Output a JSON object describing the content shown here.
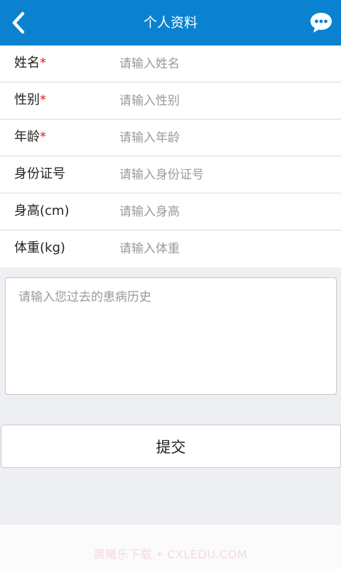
{
  "header": {
    "title": "个人资料",
    "back_icon": "chevron-left-icon",
    "chat_icon": "chat-bubble-icon"
  },
  "form": {
    "fields": [
      {
        "label": "姓名",
        "required": true,
        "placeholder": "请输入姓名",
        "value": ""
      },
      {
        "label": "性别",
        "required": true,
        "placeholder": "请输入性别",
        "value": ""
      },
      {
        "label": "年龄",
        "required": true,
        "placeholder": "请输入年龄",
        "value": ""
      },
      {
        "label": "身份证号",
        "required": false,
        "placeholder": "请输入身份证号",
        "value": ""
      },
      {
        "label": "身高(cm)",
        "required": false,
        "placeholder": "请输入身高",
        "value": ""
      },
      {
        "label": "体重(kg)",
        "required": false,
        "placeholder": "请输入体重",
        "value": ""
      }
    ],
    "required_mark": "*"
  },
  "history": {
    "placeholder": "请输入您过去的患病历史",
    "value": ""
  },
  "submit": {
    "label": "提交"
  },
  "watermark": {
    "text": "晨曦乐下载 • CXLEDU.COM"
  },
  "colors": {
    "header_bg": "#0a82d0",
    "required": "#e0262a",
    "page_bg": "#eeeff3"
  }
}
